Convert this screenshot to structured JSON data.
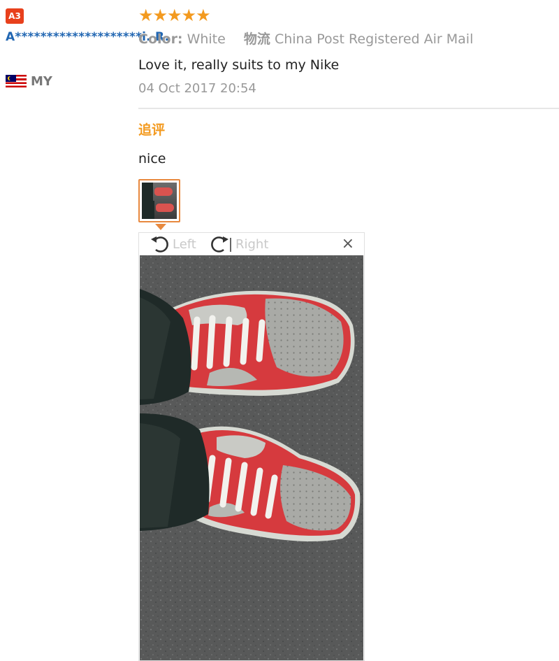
{
  "reviewer": {
    "level_badge": "A3",
    "name": "A********************i. R.",
    "country_code": "MY"
  },
  "review": {
    "stars": "★★★★★",
    "rating": 5,
    "color_label": "Color:",
    "color_value": "White",
    "shipping_label": "物流",
    "shipping_value": "China Post Registered Air Mail",
    "text": "Love it, really suits to my Nike",
    "date": "04 Oct 2017 20:54"
  },
  "followup": {
    "title": "追评",
    "text": "nice"
  },
  "viewer": {
    "rotate_left_label": "Left",
    "rotate_right_label": "Right",
    "close_label": "×"
  },
  "colors": {
    "accent_orange": "#f39a1f",
    "link_blue": "#2166b2",
    "badge_red": "#e8401c",
    "thumb_border": "#e8893f"
  }
}
